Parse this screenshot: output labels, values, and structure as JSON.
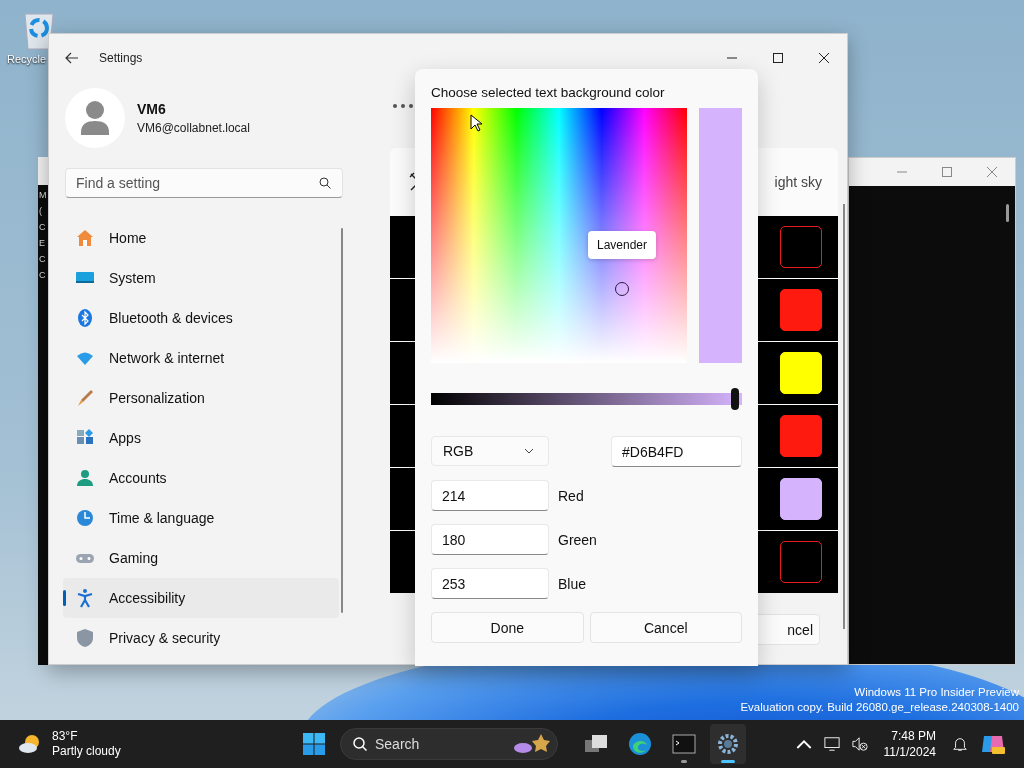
{
  "desktop": {
    "icons": [
      {
        "label": "Recycle"
      }
    ],
    "watermark": [
      "Windows 11 Pro Insider Preview",
      "Evaluation copy. Build 26080.ge_release.240308-1400"
    ]
  },
  "background_console": {
    "lines": [
      "M",
      "(",
      "C",
      "E",
      "C",
      "C"
    ]
  },
  "settings": {
    "title": "Settings",
    "user": {
      "name": "VM6",
      "email": "VM6@collabnet.local"
    },
    "search": {
      "placeholder": "Find a setting"
    },
    "nav": [
      {
        "label": "Home",
        "selected": false
      },
      {
        "label": "System",
        "selected": false
      },
      {
        "label": "Bluetooth & devices",
        "selected": false
      },
      {
        "label": "Network & internet",
        "selected": false
      },
      {
        "label": "Personalization",
        "selected": false
      },
      {
        "label": "Apps",
        "selected": false
      },
      {
        "label": "Accounts",
        "selected": false
      },
      {
        "label": "Time & language",
        "selected": false
      },
      {
        "label": "Gaming",
        "selected": false
      },
      {
        "label": "Accessibility",
        "selected": true
      },
      {
        "label": "Privacy & security",
        "selected": false
      }
    ],
    "content": {
      "card_title": "ight sky",
      "swatches": [
        {
          "color": "#000000",
          "outlined": true
        },
        {
          "color": "#ff1a0f",
          "outlined": false
        },
        {
          "color": "#ffff00",
          "outlined": false
        },
        {
          "color": "#ff1a0f",
          "outlined": false
        },
        {
          "color": "#d6b4fd",
          "outlined": false
        },
        {
          "color": "#000000",
          "outlined": true
        }
      ],
      "cancel_button": "ncel"
    }
  },
  "color_dialog": {
    "title": "Choose selected text background color",
    "tooltip": "Lavender",
    "hex": "#D6B4FD",
    "level": 0.99,
    "mode": "RGB",
    "channels": [
      {
        "value": "214",
        "label": "Red"
      },
      {
        "value": "180",
        "label": "Green"
      },
      {
        "value": "253",
        "label": "Blue"
      }
    ],
    "buttons": [
      "Done",
      "Cancel"
    ]
  },
  "taskbar": {
    "weather": {
      "temp": "83°F",
      "condition": "Partly cloudy"
    },
    "search": {
      "placeholder": "Search"
    },
    "apps": [
      {
        "running": false,
        "selected": false
      },
      {
        "running": false,
        "selected": false
      },
      {
        "running": true,
        "selected": false
      },
      {
        "running": true,
        "selected": true
      }
    ],
    "time": "7:48 PM",
    "date": "11/1/2024"
  }
}
